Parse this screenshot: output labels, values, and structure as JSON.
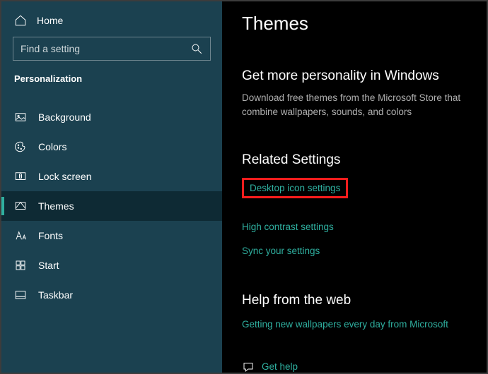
{
  "sidebar": {
    "home": "Home",
    "search_placeholder": "Find a setting",
    "category": "Personalization",
    "items": [
      {
        "label": "Background"
      },
      {
        "label": "Colors"
      },
      {
        "label": "Lock screen"
      },
      {
        "label": "Themes"
      },
      {
        "label": "Fonts"
      },
      {
        "label": "Start"
      },
      {
        "label": "Taskbar"
      }
    ]
  },
  "main": {
    "title": "Themes",
    "personality": {
      "heading": "Get more personality in Windows",
      "sub": "Download free themes from the Microsoft Store that combine wallpapers, sounds, and colors"
    },
    "related": {
      "heading": "Related Settings",
      "links": {
        "desktop_icon": "Desktop icon settings",
        "high_contrast": "High contrast settings",
        "sync": "Sync your settings"
      }
    },
    "help": {
      "heading": "Help from the web",
      "wallpapers_link": "Getting new wallpapers every day from Microsoft",
      "get_help": "Get help"
    }
  }
}
